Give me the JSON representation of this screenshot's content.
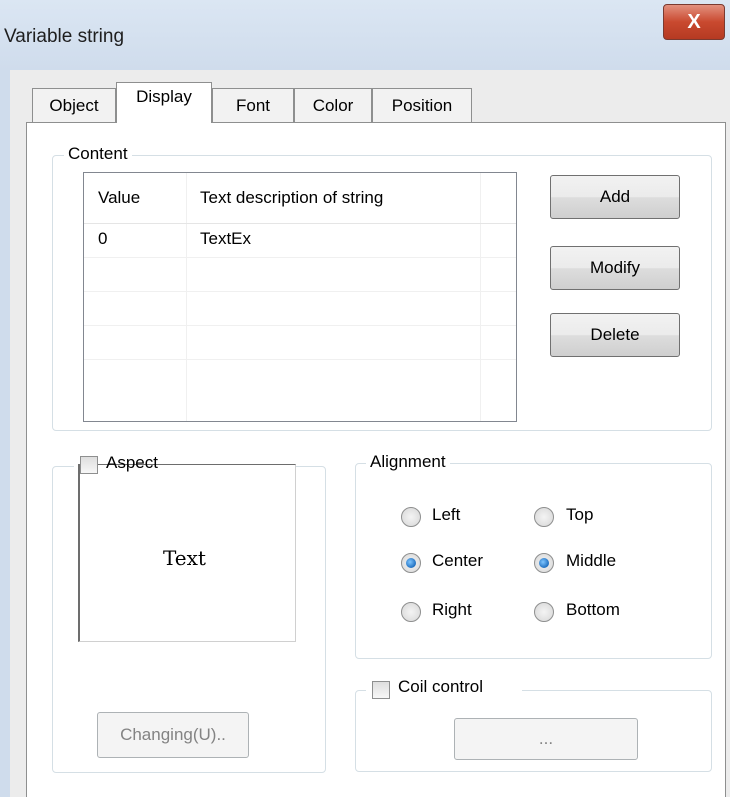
{
  "window": {
    "title": "Variable string",
    "close_glyph": "X"
  },
  "tabs": [
    {
      "label": "Object",
      "active": false
    },
    {
      "label": "Display",
      "active": true
    },
    {
      "label": "Font",
      "active": false
    },
    {
      "label": "Color",
      "active": false
    },
    {
      "label": "Position",
      "active": false
    }
  ],
  "content": {
    "legend": "Content",
    "columns": [
      "Value",
      "Text description of string"
    ],
    "rows": [
      {
        "value": "0",
        "text": "TextEx"
      }
    ],
    "buttons": {
      "add": "Add",
      "modify": "Modify",
      "delete": "Delete"
    }
  },
  "aspect": {
    "label": "Aspect",
    "checked": false,
    "preview_text": "Text",
    "changing_button": "Changing(U).."
  },
  "alignment": {
    "legend": "Alignment",
    "horizontal": [
      {
        "label": "Left",
        "selected": false
      },
      {
        "label": "Center",
        "selected": true
      },
      {
        "label": "Right",
        "selected": false
      }
    ],
    "vertical": [
      {
        "label": "Top",
        "selected": false
      },
      {
        "label": "Middle",
        "selected": true
      },
      {
        "label": "Bottom",
        "selected": false
      }
    ]
  },
  "coil_control": {
    "label": "Coil control",
    "checked": false,
    "button_label": "..."
  },
  "colors": {
    "titlebar": "#cfdcec",
    "close": "#c9492f",
    "radio_selected": "#1f6fc0"
  }
}
